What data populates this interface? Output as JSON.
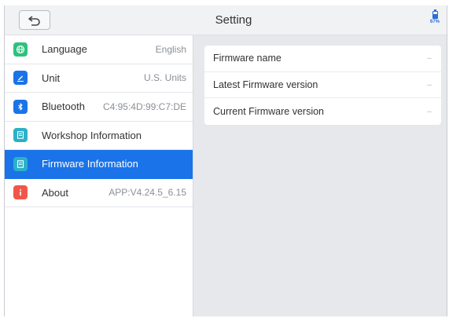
{
  "header": {
    "title": "Setting",
    "battery_percent": "67%",
    "battery_level": 0.67
  },
  "colors": {
    "accent": "#1a73e8",
    "icon_language": "#2ec27e",
    "icon_unit": "#1a73e8",
    "icon_bluetooth": "#1a73e8",
    "icon_workshop": "#2bb0c8",
    "icon_firmware": "#2bb0c8",
    "icon_about": "#f0574a"
  },
  "sidebar": {
    "items": [
      {
        "label": "Language",
        "value": "English",
        "icon": "globe-icon"
      },
      {
        "label": "Unit",
        "value": "U.S. Units",
        "icon": "pencil-icon"
      },
      {
        "label": "Bluetooth",
        "value": "C4:95:4D:99:C7:DE",
        "icon": "bluetooth-icon"
      },
      {
        "label": "Workshop Information",
        "value": "",
        "icon": "document-icon"
      },
      {
        "label": "Firmware Information",
        "value": "",
        "icon": "document-icon",
        "selected": true
      },
      {
        "label": "About",
        "value": "APP:V4.24.5_6.15",
        "icon": "info-icon"
      }
    ]
  },
  "main": {
    "rows": [
      {
        "label": "Firmware name",
        "value": "--"
      },
      {
        "label": "Latest Firmware version",
        "value": "--"
      },
      {
        "label": "Current Firmware version",
        "value": "--"
      }
    ]
  }
}
